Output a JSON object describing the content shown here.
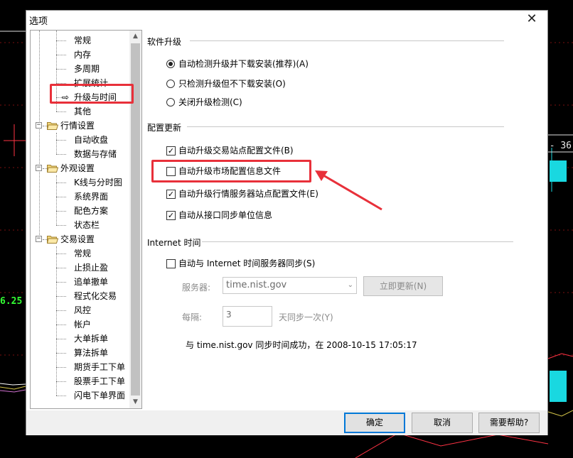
{
  "background": {
    "price_left": "6.25",
    "price_right": "- 36"
  },
  "dialog": {
    "title": "选项",
    "close_glyph": "✕"
  },
  "tree": {
    "items": [
      {
        "label": "常规",
        "level": 2
      },
      {
        "label": "内存",
        "level": 2
      },
      {
        "label": "多周期",
        "level": 2
      },
      {
        "label": "扩展统计",
        "level": 2
      },
      {
        "label": "升级与时间",
        "level": 2,
        "selected": true,
        "marker": "⇨"
      },
      {
        "label": "其他",
        "level": 2
      },
      {
        "label": "行情设置",
        "level": 1,
        "expander": "−"
      },
      {
        "label": "自动收盘",
        "level": 2
      },
      {
        "label": "数据与存储",
        "level": 2
      },
      {
        "label": "外观设置",
        "level": 1,
        "expander": "−"
      },
      {
        "label": "K线与分时图",
        "level": 2
      },
      {
        "label": "系统界面",
        "level": 2
      },
      {
        "label": "配色方案",
        "level": 2
      },
      {
        "label": "状态栏",
        "level": 2
      },
      {
        "label": "交易设置",
        "level": 1,
        "expander": "−"
      },
      {
        "label": "常规",
        "level": 2
      },
      {
        "label": "止损止盈",
        "level": 2
      },
      {
        "label": "追单撤单",
        "level": 2
      },
      {
        "label": "程式化交易",
        "level": 2
      },
      {
        "label": "风控",
        "level": 2
      },
      {
        "label": "帐户",
        "level": 2
      },
      {
        "label": "大单拆单",
        "level": 2
      },
      {
        "label": "算法拆单",
        "level": 2
      },
      {
        "label": "期货手工下单",
        "level": 2
      },
      {
        "label": "股票手工下单",
        "level": 2
      },
      {
        "label": "闪电下单界面",
        "level": 2
      }
    ],
    "scroll_up": "▲",
    "scroll_down": "▼"
  },
  "upgrade": {
    "title": "软件升级",
    "options": [
      {
        "label": "自动检测升级并下载安装(推荐)(A)",
        "checked": true
      },
      {
        "label": "只检测升级但不下载安装(O)",
        "checked": false
      },
      {
        "label": "关闭升级检测(C)",
        "checked": false
      }
    ]
  },
  "config": {
    "title": "配置更新",
    "options": [
      {
        "label": "自动升级交易站点配置文件(B)",
        "checked": true
      },
      {
        "label": "自动升级市场配置信息文件",
        "checked": false
      },
      {
        "label": "自动升级行情服务器站点配置文件(E)",
        "checked": true
      },
      {
        "label": "自动从接口同步单位信息",
        "checked": true
      }
    ]
  },
  "internet_time": {
    "title": "Internet 时间",
    "sync_label": "自动与 Internet 时间服务器同步(S)",
    "sync_checked": false,
    "server_label": "服务器:",
    "server_value": "time.nist.gov",
    "update_now": "立即更新(N)",
    "interval_label": "每隔:",
    "interval_value": "3",
    "interval_unit": "天同步一次(Y)",
    "status": "与 time.nist.gov 同步时间成功，在 2008-10-15 17:05:17"
  },
  "footer": {
    "ok": "确定",
    "cancel": "取消",
    "help": "需要帮助?"
  },
  "colors": {
    "highlight": "#e8303a",
    "accent": "#0078d7",
    "chart_cyan": "#19d8e0"
  }
}
